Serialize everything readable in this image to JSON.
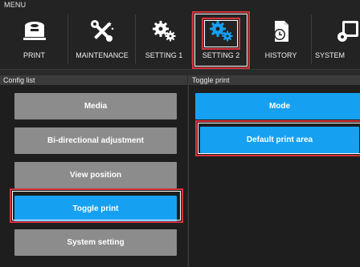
{
  "menu": {
    "title": "MENU",
    "tabs": [
      {
        "label": "PRINT",
        "icon": "print-icon"
      },
      {
        "label": "MAINTENANCE",
        "icon": "tools-icon"
      },
      {
        "label": "SETTING 1",
        "icon": "gears-icon"
      },
      {
        "label": "SETTING 2",
        "icon": "gears-blue-icon",
        "active": true
      },
      {
        "label": "HISTORY",
        "icon": "document-clock-icon"
      },
      {
        "label": "SYSTEM",
        "icon": "system-gear-icon"
      }
    ]
  },
  "config_list": {
    "title": "Config list",
    "items": [
      {
        "label": "Media",
        "selected": false
      },
      {
        "label": "Bi-directional adjustment",
        "selected": false
      },
      {
        "label": "View position",
        "selected": false
      },
      {
        "label": "Toggle print",
        "selected": true
      },
      {
        "label": "System setting",
        "selected": false
      }
    ]
  },
  "toggle_print": {
    "title": "Toggle print",
    "items": [
      {
        "label": "Mode"
      },
      {
        "label": "Default print area"
      }
    ]
  },
  "colors": {
    "accent": "#16a0f2",
    "button_gray": "#8c8c8c",
    "highlight": "#d5333c",
    "background": "#1e1e1e"
  }
}
